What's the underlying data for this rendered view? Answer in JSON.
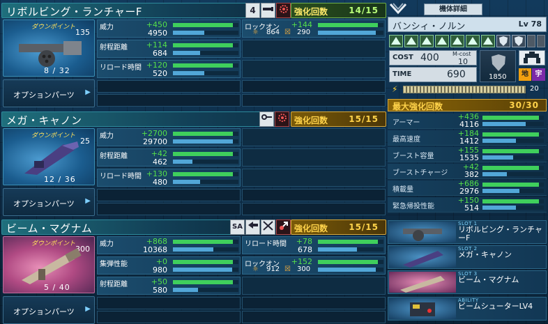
{
  "weapons": [
    {
      "name": "リボルビング・ランチャーF",
      "icons": [
        "4",
        "ammo-icon",
        "gear-icon"
      ],
      "enh_label": "強化回数",
      "enh_value": "14/15",
      "enh_style": "green",
      "dp_label": "ダウンポイント",
      "dp_value": "135",
      "ammo": "8 /   32",
      "option_label": "オプションパーツ",
      "stats": [
        {
          "name": "威力",
          "plus": "+450",
          "value": "4950",
          "bar_plus": 0.92,
          "bar_val": 0.48
        },
        {
          "name": "射程距離",
          "plus": "+114",
          "value": "684",
          "bar_plus": 0.92,
          "bar_val": 0.42
        },
        {
          "name": "リロード時間",
          "plus": "+120",
          "value": "520",
          "bar_plus": 0.92,
          "bar_val": 0.48
        }
      ],
      "extra": {
        "name": "ロックオン",
        "plus": "+144",
        "lock1": "864",
        "lock2": "290",
        "bar_plus": 0.92,
        "bar_val": 0.88
      }
    },
    {
      "name": "メガ・キャノン",
      "icons": [
        "charge-icon",
        "gear-icon"
      ],
      "enh_label": "強化回数",
      "enh_value": "15/15",
      "enh_style": "gold",
      "dp_label": "ダウンポイント",
      "dp_value": "25",
      "ammo": "12 /   36",
      "option_label": "オプションパーツ",
      "stats": [
        {
          "name": "威力",
          "plus": "+2700",
          "value": "29700",
          "bar_plus": 0.92,
          "bar_val": 0.92
        },
        {
          "name": "射程距離",
          "plus": "+42",
          "value": "462",
          "bar_plus": 0.92,
          "bar_val": 0.3
        },
        {
          "name": "リロード時間",
          "plus": "+130",
          "value": "480",
          "bar_plus": 0.92,
          "bar_val": 0.42
        }
      ]
    },
    {
      "name": "ビーム・マグナム",
      "icons": [
        "SA",
        "arrow-icon",
        "cross-arrow-icon",
        "swap-icon"
      ],
      "enh_label": "強化回数",
      "enh_value": "15/15",
      "enh_style": "gold",
      "dp_label": "ダウンポイント",
      "dp_value": "300",
      "ammo": "5 /   40",
      "option_label": "オプションパーツ",
      "stats": [
        {
          "name": "威力",
          "plus": "+868",
          "value": "10368",
          "bar_plus": 0.92,
          "bar_val": 0.62
        },
        {
          "name": "集弾性能",
          "plus": "+0",
          "value": "980",
          "bar_plus": 0.92,
          "bar_val": 0.9
        },
        {
          "name": "射程距離",
          "plus": "+50",
          "value": "580",
          "bar_plus": 0.92,
          "bar_val": 0.38
        }
      ],
      "extra2": [
        {
          "name": "リロード時間",
          "plus": "+78",
          "value": "678",
          "bar_plus": 0.92,
          "bar_val": 0.6
        },
        {
          "name": "ロックオン",
          "plus": "+152",
          "lock1": "912",
          "lock2": "300",
          "bar_plus": 0.92,
          "bar_val": 0.88
        }
      ]
    }
  ],
  "unit": {
    "detail_btn": "機体詳細",
    "name": "バンシィ・ノルン",
    "level": "Lv 78",
    "cost_label": "COST",
    "cost": "400",
    "mcost_label": "M-cost",
    "mcost": "10",
    "time_label": "TIME",
    "time": "690",
    "hp": "1850",
    "map": [
      "地",
      "宇"
    ],
    "boost": "20",
    "max_enh_label": "最大強化回数",
    "max_enh": "30/30"
  },
  "unit_stats": [
    {
      "name": "アーマー",
      "plus": "+436",
      "value": "4116",
      "bar_plus": 0.92,
      "bar_val": 0.7
    },
    {
      "name": "最高速度",
      "plus": "+184",
      "value": "1412",
      "bar_plus": 0.92,
      "bar_val": 0.55
    },
    {
      "name": "ブースト容量",
      "plus": "+155",
      "value": "1535",
      "bar_plus": 0.92,
      "bar_val": 0.5
    },
    {
      "name": "ブーストチャージ",
      "plus": "+42",
      "value": "382",
      "bar_plus": 0.92,
      "bar_val": 0.4
    },
    {
      "name": "積載量",
      "plus": "+686",
      "value": "2976",
      "bar_plus": 0.92,
      "bar_val": 0.6
    },
    {
      "name": "緊急帰投性能",
      "plus": "+150",
      "value": "514",
      "bar_plus": 0.92,
      "bar_val": 0.55
    }
  ],
  "slots": [
    {
      "tag": "SLOT 1",
      "name": "リボルビング・ランチャーF"
    },
    {
      "tag": "SLOT 2",
      "name": "メガ・キャノン"
    },
    {
      "tag": "SLOT 3",
      "name": "ビーム・マグナム"
    },
    {
      "tag": "ABILITY",
      "name": "ビームシューターLV4"
    }
  ],
  "colors": {
    "green": "#3fcf5c",
    "blue": "#52a7d8",
    "gold": "#d8a83a",
    "plus": "#55e04a"
  }
}
